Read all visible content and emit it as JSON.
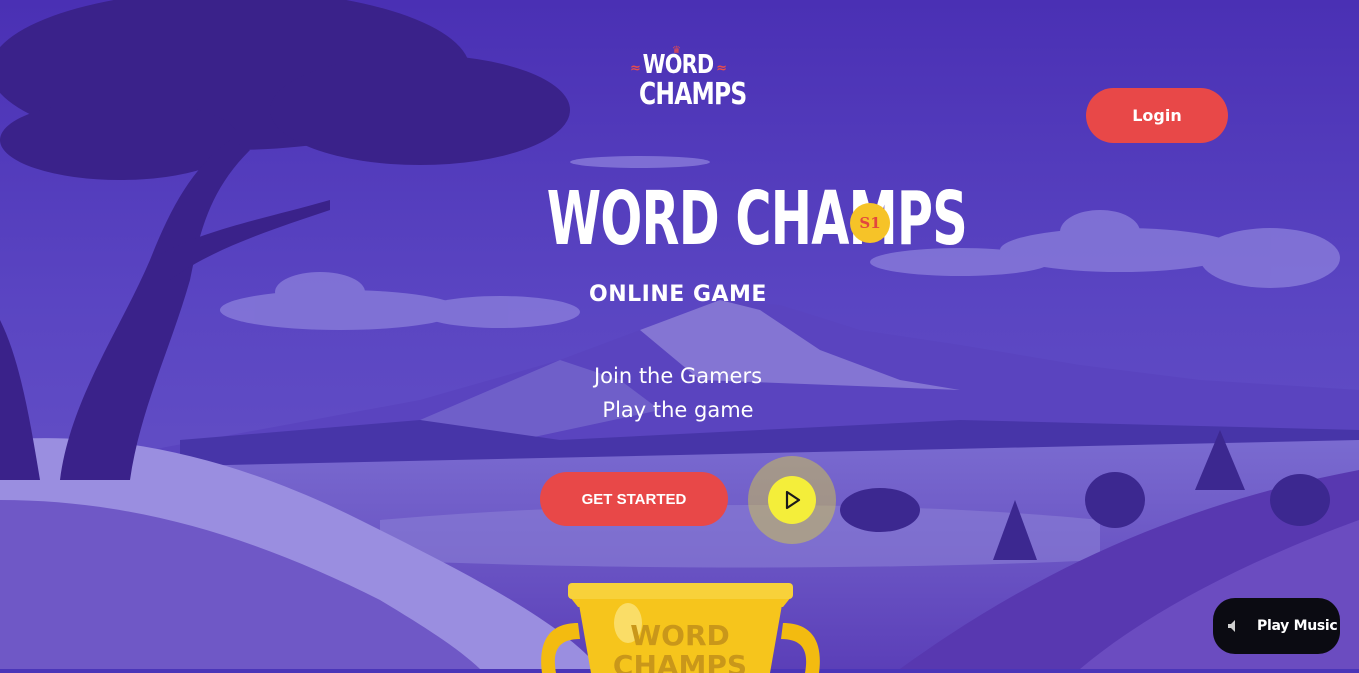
{
  "brand": {
    "logo_line1": "WORD",
    "logo_line2": "CHAMPS"
  },
  "header": {
    "login_label": "Login"
  },
  "hero": {
    "title": "WORD CHAMPS",
    "season_badge": "S1",
    "subtitle": "ONLINE GAME",
    "tagline_1": "Join the Gamers",
    "tagline_2": "Play the game",
    "cta_label": "GET STARTED",
    "play_icon": "play-icon"
  },
  "trophy": {
    "logo_line1": "WORD",
    "logo_line2": "CHAMPS"
  },
  "music": {
    "label": "Play Music",
    "icon": "speaker-icon"
  },
  "colors": {
    "accent_red": "#e84848",
    "badge_yellow": "#f6c328",
    "play_yellow": "#f4ee3a",
    "sky_purple": "#4a35b8"
  }
}
